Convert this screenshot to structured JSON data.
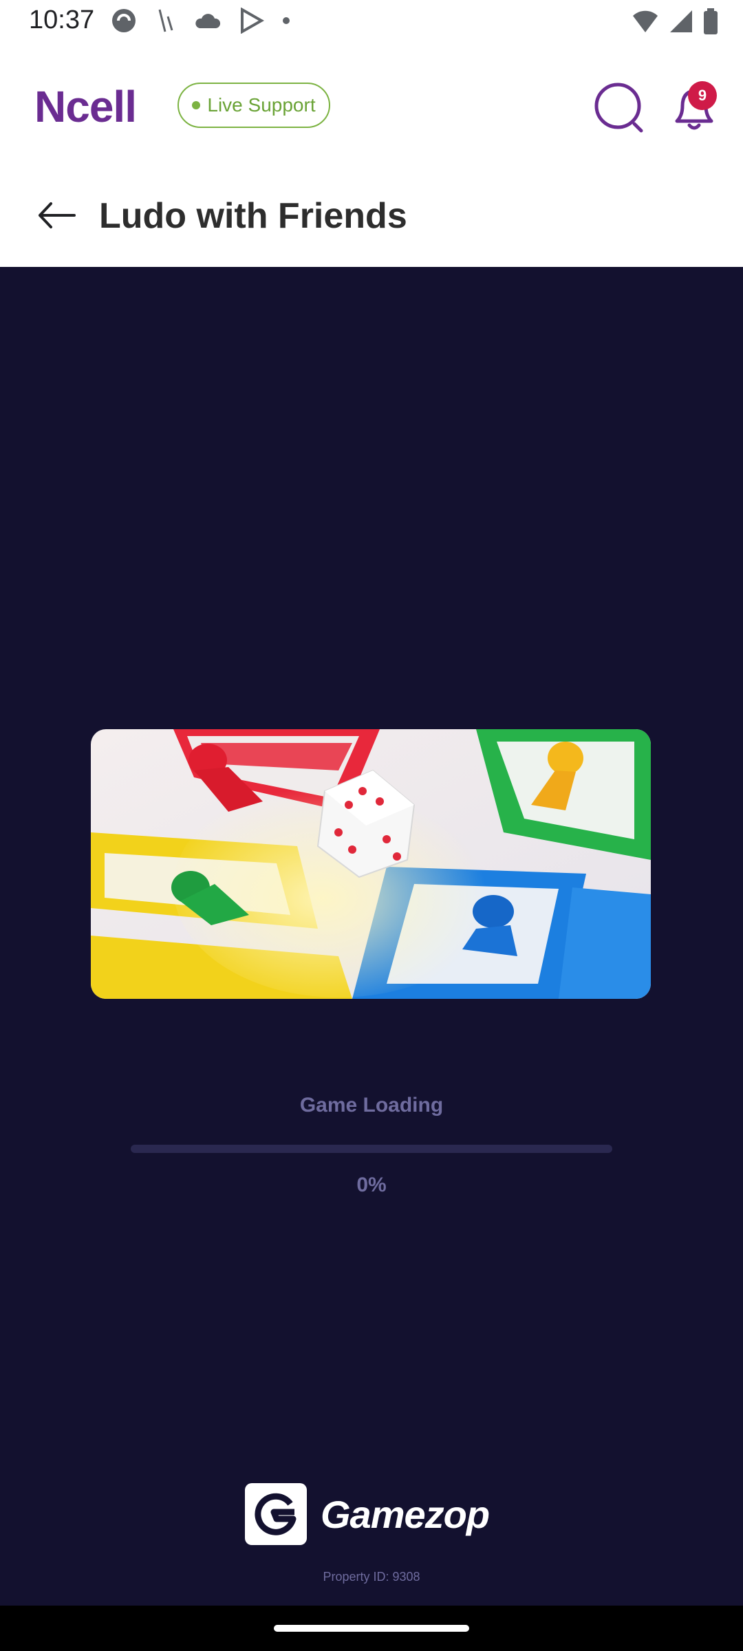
{
  "status_bar": {
    "time": "10:37",
    "icons": [
      "app-notification-icon",
      "signal-slash-icon",
      "cloud-icon",
      "play-store-icon",
      "dot-icon",
      "wifi-icon",
      "cell-signal-icon",
      "battery-icon"
    ]
  },
  "header": {
    "logo": "Ncell",
    "live_support_label": "Live Support",
    "notification_count": "9",
    "brand_color": "#6a2c91",
    "accent_green": "#7cb342"
  },
  "page": {
    "title": "Ludo with Friends"
  },
  "game": {
    "loading_label": "Game Loading",
    "progress_percent_text": "0%",
    "progress_value": 0,
    "brand_name": "Gamezop",
    "property_id_text": "Property ID: 9308",
    "background_color": "#13112f"
  }
}
